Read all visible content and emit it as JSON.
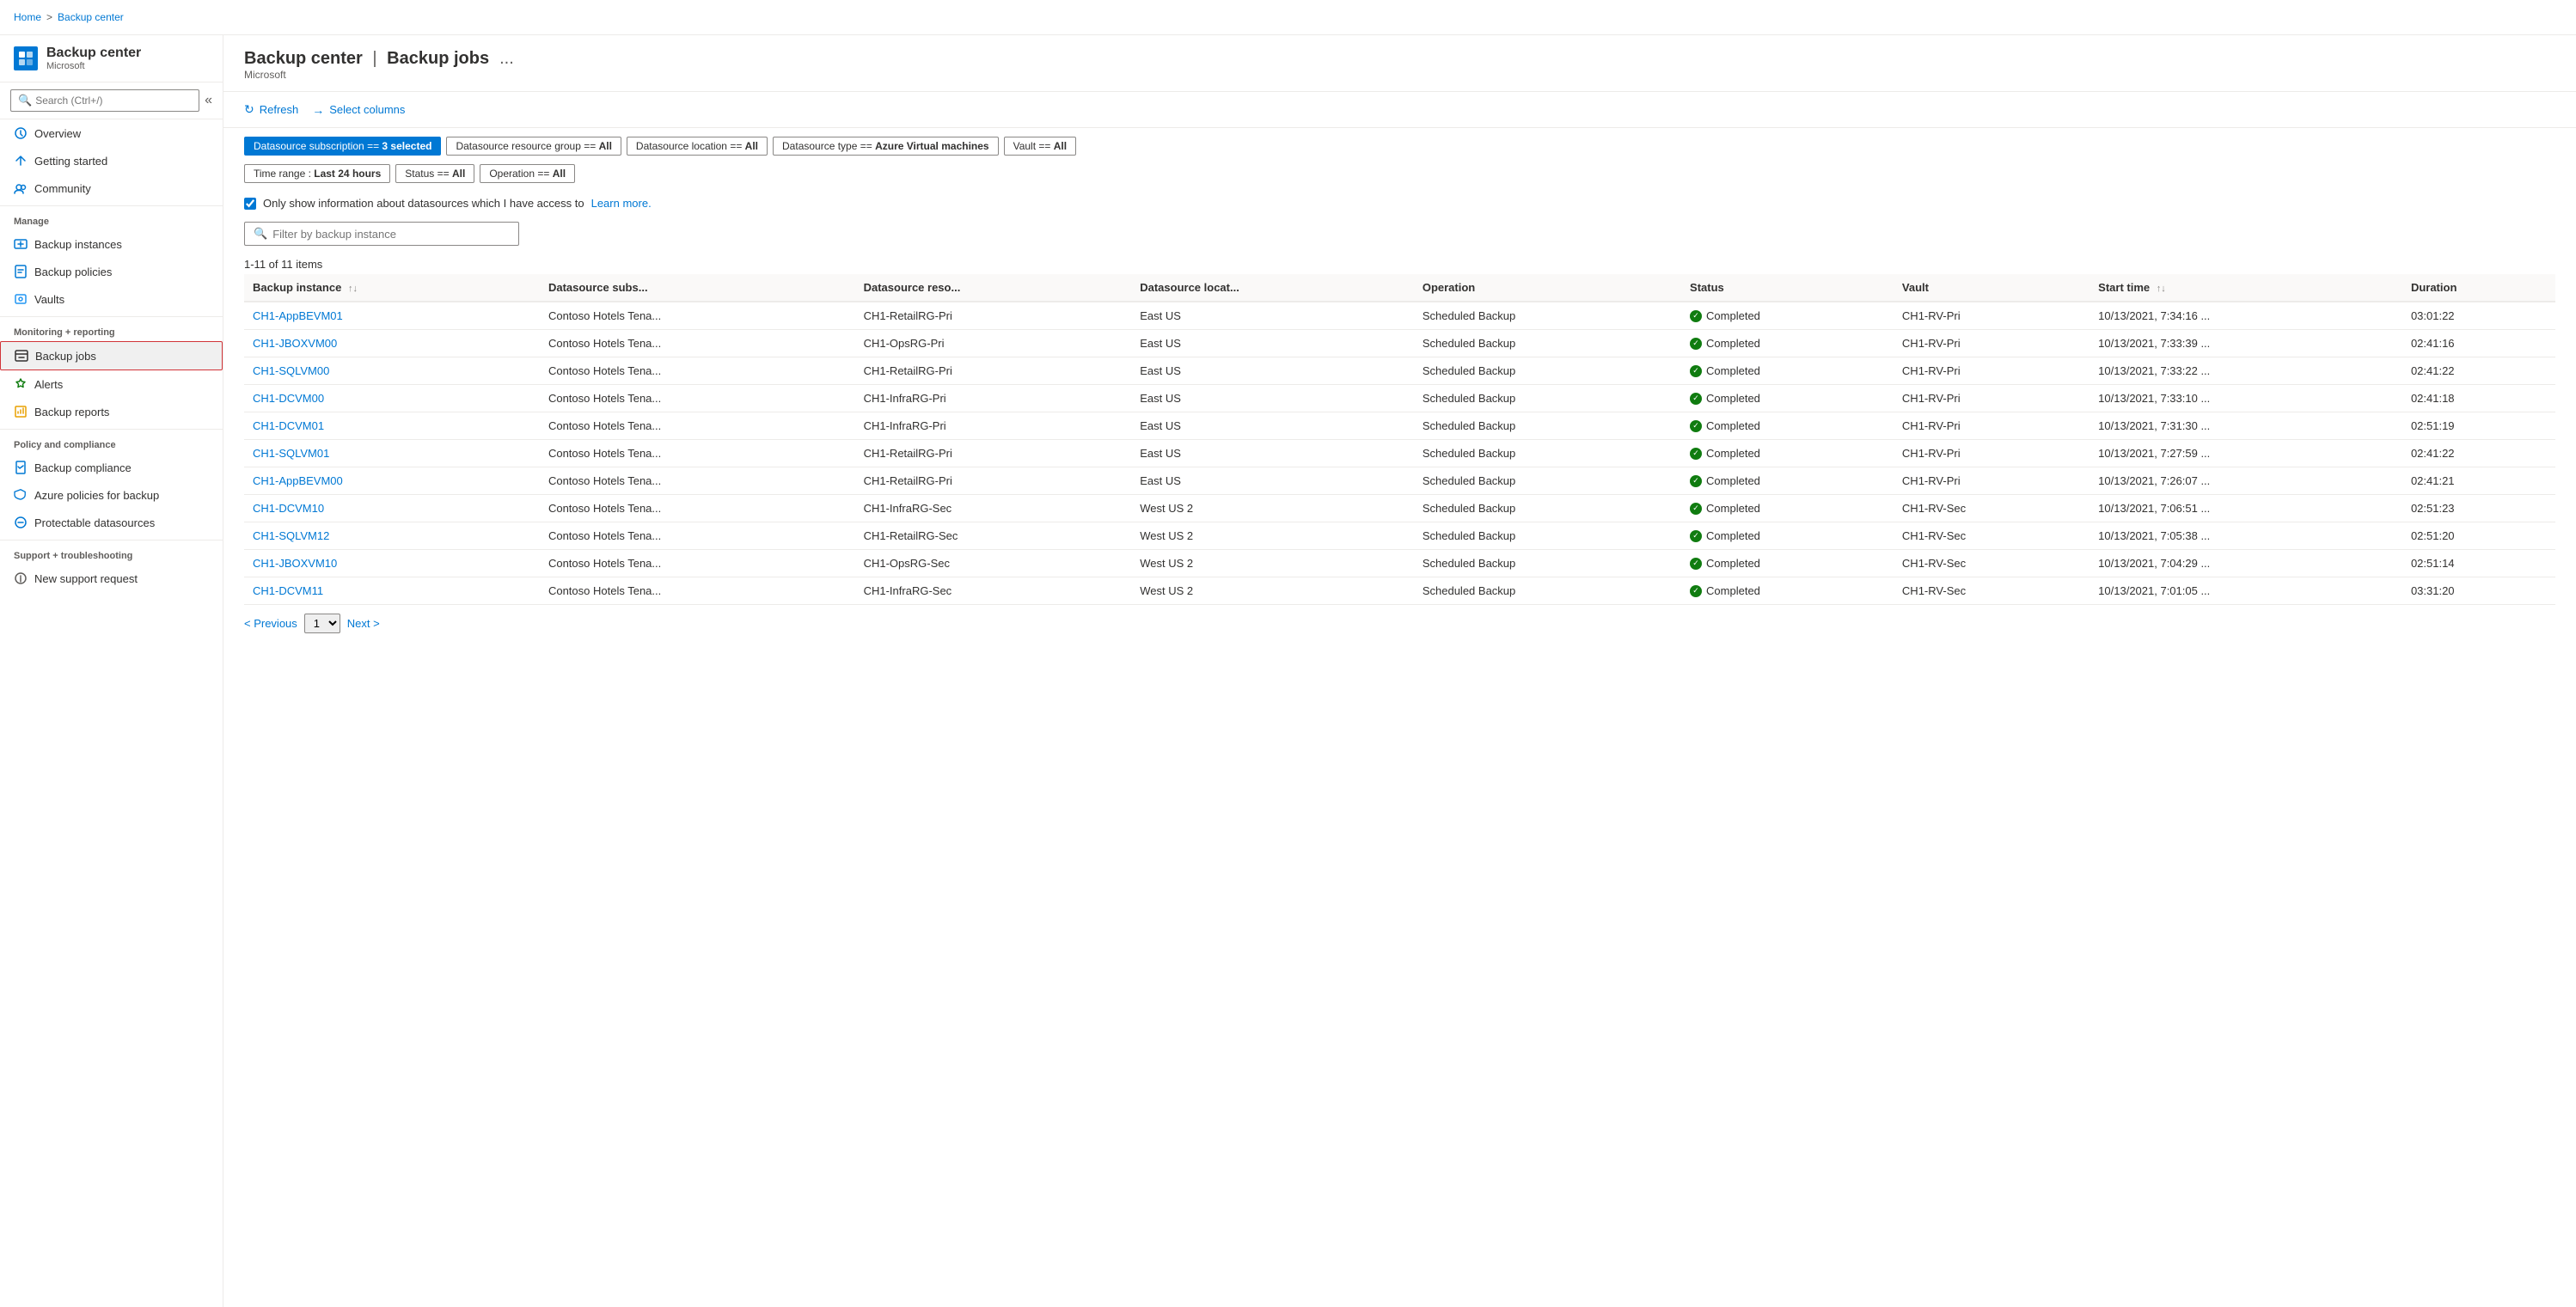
{
  "topbar": {
    "breadcrumbs": [
      {
        "label": "Home",
        "href": true
      },
      {
        "label": "Backup center",
        "href": true
      }
    ],
    "separator": ">"
  },
  "sidebar": {
    "logo_text": "BC",
    "title": "Backup center",
    "subtitle": "Microsoft",
    "search_placeholder": "Search (Ctrl+/)",
    "collapse_icon": "«",
    "nav_sections": [
      {
        "items": [
          {
            "id": "overview",
            "label": "Overview",
            "icon": "overview"
          },
          {
            "id": "getting-started",
            "label": "Getting started",
            "icon": "getting-started"
          },
          {
            "id": "community",
            "label": "Community",
            "icon": "community"
          }
        ]
      },
      {
        "header": "Manage",
        "items": [
          {
            "id": "backup-instances",
            "label": "Backup instances",
            "icon": "backup-instances"
          },
          {
            "id": "backup-policies",
            "label": "Backup policies",
            "icon": "backup-policies"
          },
          {
            "id": "vaults",
            "label": "Vaults",
            "icon": "vaults"
          }
        ]
      },
      {
        "header": "Monitoring + reporting",
        "items": [
          {
            "id": "backup-jobs",
            "label": "Backup jobs",
            "icon": "backup-jobs",
            "active": true
          },
          {
            "id": "alerts",
            "label": "Alerts",
            "icon": "alerts"
          },
          {
            "id": "backup-reports",
            "label": "Backup reports",
            "icon": "backup-reports"
          }
        ]
      },
      {
        "header": "Policy and compliance",
        "items": [
          {
            "id": "backup-compliance",
            "label": "Backup compliance",
            "icon": "backup-compliance"
          },
          {
            "id": "azure-policies",
            "label": "Azure policies for backup",
            "icon": "azure-policies"
          },
          {
            "id": "protectable-datasources",
            "label": "Protectable datasources",
            "icon": "protectable-datasources"
          }
        ]
      },
      {
        "header": "Support + troubleshooting",
        "items": [
          {
            "id": "new-support-request",
            "label": "New support request",
            "icon": "new-support-request"
          }
        ]
      }
    ]
  },
  "page": {
    "title": "Backup center",
    "pipe": "|",
    "subtitle": "Backup jobs",
    "more_icon": "..."
  },
  "toolbar": {
    "refresh_label": "Refresh",
    "select_columns_label": "Select columns"
  },
  "filters": [
    {
      "id": "datasource-subscription",
      "label": "Datasource subscription == 3 selected",
      "active": true
    },
    {
      "id": "datasource-resource-group",
      "label": "Datasource resource group == All",
      "active": false
    },
    {
      "id": "datasource-location",
      "label": "Datasource location == All",
      "active": false
    },
    {
      "id": "datasource-type",
      "label": "Datasource type == Azure Virtual machines",
      "active": false
    },
    {
      "id": "vault",
      "label": "Vault == All",
      "active": false
    },
    {
      "id": "time-range",
      "label": "Time range : Last 24 hours",
      "active": false
    },
    {
      "id": "status",
      "label": "Status == All",
      "active": false
    },
    {
      "id": "operation",
      "label": "Operation == All",
      "active": false
    }
  ],
  "checkbox": {
    "label": "Only show information about datasources which I have access to",
    "link_text": "Learn more.",
    "checked": true
  },
  "filter_input": {
    "placeholder": "Filter by backup instance"
  },
  "count_label": "1-11 of 11 items",
  "table": {
    "columns": [
      {
        "id": "backup-instance",
        "label": "Backup instance",
        "sortable": true
      },
      {
        "id": "datasource-subs",
        "label": "Datasource subs...",
        "sortable": false
      },
      {
        "id": "datasource-reso",
        "label": "Datasource reso...",
        "sortable": false
      },
      {
        "id": "datasource-locat",
        "label": "Datasource locat...",
        "sortable": false
      },
      {
        "id": "operation",
        "label": "Operation",
        "sortable": false
      },
      {
        "id": "status",
        "label": "Status",
        "sortable": false
      },
      {
        "id": "vault",
        "label": "Vault",
        "sortable": false
      },
      {
        "id": "start-time",
        "label": "Start time",
        "sortable": true
      },
      {
        "id": "duration",
        "label": "Duration",
        "sortable": false
      }
    ],
    "rows": [
      {
        "backup_instance": "CH1-AppBEVM01",
        "datasource_subs": "Contoso Hotels Tena...",
        "datasource_reso": "CH1-RetailRG-Pri",
        "datasource_locat": "East US",
        "operation": "Scheduled Backup",
        "status": "Completed",
        "vault": "CH1-RV-Pri",
        "start_time": "10/13/2021, 7:34:16 ...",
        "duration": "03:01:22"
      },
      {
        "backup_instance": "CH1-JBOXVM00",
        "datasource_subs": "Contoso Hotels Tena...",
        "datasource_reso": "CH1-OpsRG-Pri",
        "datasource_locat": "East US",
        "operation": "Scheduled Backup",
        "status": "Completed",
        "vault": "CH1-RV-Pri",
        "start_time": "10/13/2021, 7:33:39 ...",
        "duration": "02:41:16"
      },
      {
        "backup_instance": "CH1-SQLVM00",
        "datasource_subs": "Contoso Hotels Tena...",
        "datasource_reso": "CH1-RetailRG-Pri",
        "datasource_locat": "East US",
        "operation": "Scheduled Backup",
        "status": "Completed",
        "vault": "CH1-RV-Pri",
        "start_time": "10/13/2021, 7:33:22 ...",
        "duration": "02:41:22"
      },
      {
        "backup_instance": "CH1-DCVM00",
        "datasource_subs": "Contoso Hotels Tena...",
        "datasource_reso": "CH1-InfraRG-Pri",
        "datasource_locat": "East US",
        "operation": "Scheduled Backup",
        "status": "Completed",
        "vault": "CH1-RV-Pri",
        "start_time": "10/13/2021, 7:33:10 ...",
        "duration": "02:41:18"
      },
      {
        "backup_instance": "CH1-DCVM01",
        "datasource_subs": "Contoso Hotels Tena...",
        "datasource_reso": "CH1-InfraRG-Pri",
        "datasource_locat": "East US",
        "operation": "Scheduled Backup",
        "status": "Completed",
        "vault": "CH1-RV-Pri",
        "start_time": "10/13/2021, 7:31:30 ...",
        "duration": "02:51:19"
      },
      {
        "backup_instance": "CH1-SQLVM01",
        "datasource_subs": "Contoso Hotels Tena...",
        "datasource_reso": "CH1-RetailRG-Pri",
        "datasource_locat": "East US",
        "operation": "Scheduled Backup",
        "status": "Completed",
        "vault": "CH1-RV-Pri",
        "start_time": "10/13/2021, 7:27:59 ...",
        "duration": "02:41:22"
      },
      {
        "backup_instance": "CH1-AppBEVM00",
        "datasource_subs": "Contoso Hotels Tena...",
        "datasource_reso": "CH1-RetailRG-Pri",
        "datasource_locat": "East US",
        "operation": "Scheduled Backup",
        "status": "Completed",
        "vault": "CH1-RV-Pri",
        "start_time": "10/13/2021, 7:26:07 ...",
        "duration": "02:41:21"
      },
      {
        "backup_instance": "CH1-DCVM10",
        "datasource_subs": "Contoso Hotels Tena...",
        "datasource_reso": "CH1-InfraRG-Sec",
        "datasource_locat": "West US 2",
        "operation": "Scheduled Backup",
        "status": "Completed",
        "vault": "CH1-RV-Sec",
        "start_time": "10/13/2021, 7:06:51 ...",
        "duration": "02:51:23"
      },
      {
        "backup_instance": "CH1-SQLVM12",
        "datasource_subs": "Contoso Hotels Tena...",
        "datasource_reso": "CH1-RetailRG-Sec",
        "datasource_locat": "West US 2",
        "operation": "Scheduled Backup",
        "status": "Completed",
        "vault": "CH1-RV-Sec",
        "start_time": "10/13/2021, 7:05:38 ...",
        "duration": "02:51:20"
      },
      {
        "backup_instance": "CH1-JBOXVM10",
        "datasource_subs": "Contoso Hotels Tena...",
        "datasource_reso": "CH1-OpsRG-Sec",
        "datasource_locat": "West US 2",
        "operation": "Scheduled Backup",
        "status": "Completed",
        "vault": "CH1-RV-Sec",
        "start_time": "10/13/2021, 7:04:29 ...",
        "duration": "02:51:14"
      },
      {
        "backup_instance": "CH1-DCVM11",
        "datasource_subs": "Contoso Hotels Tena...",
        "datasource_reso": "CH1-InfraRG-Sec",
        "datasource_locat": "West US 2",
        "operation": "Scheduled Backup",
        "status": "Completed",
        "vault": "CH1-RV-Sec",
        "start_time": "10/13/2021, 7:01:05 ...",
        "duration": "03:31:20"
      }
    ]
  },
  "pagination": {
    "previous_label": "< Previous",
    "next_label": "Next >",
    "page_value": "1"
  }
}
